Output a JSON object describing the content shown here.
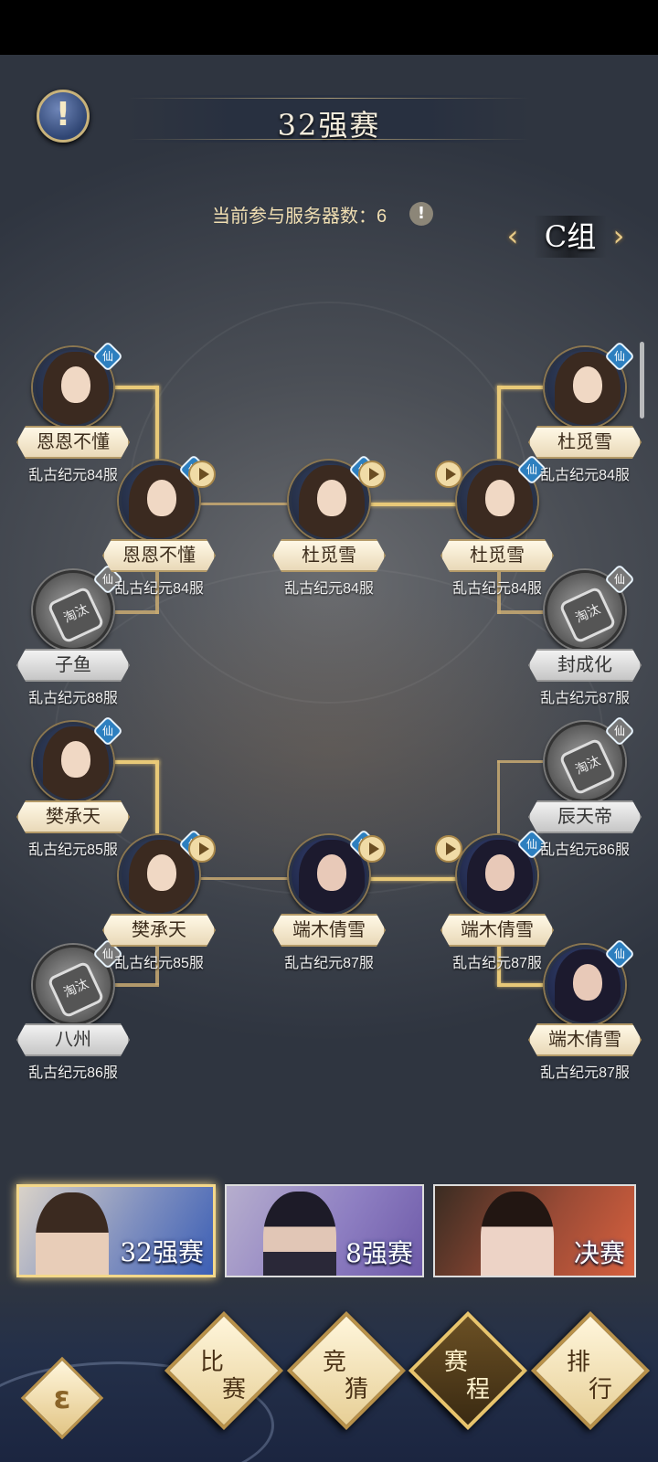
{
  "header": {
    "title": "32强赛",
    "server_count_label": "当前参与服务器数：6",
    "info_icon": "!",
    "small_info_icon": "!"
  },
  "group": {
    "label": "C组",
    "prev": "‹",
    "next": "›"
  },
  "badge_text": "仙",
  "bracket": {
    "top": {
      "left_r1": [
        {
          "name": "恩恩不懂",
          "server": "乱古纪元84服",
          "status": "winner"
        },
        {
          "name": "子鱼",
          "server": "乱古纪元88服",
          "status": "eliminated"
        }
      ],
      "left_r2": {
        "name": "恩恩不懂",
        "server": "乱古纪元84服"
      },
      "center": {
        "name": "杜觅雪",
        "server": "乱古纪元84服"
      },
      "right_r2": {
        "name": "杜觅雪",
        "server": "乱古纪元84服"
      },
      "right_r1": [
        {
          "name": "杜觅雪",
          "server": "乱古纪元84服",
          "status": "winner"
        },
        {
          "name": "封成化",
          "server": "乱古纪元87服",
          "status": "eliminated"
        }
      ]
    },
    "bottom": {
      "left_r1": [
        {
          "name": "樊承天",
          "server": "乱古纪元85服",
          "status": "winner"
        },
        {
          "name": "八州",
          "server": "乱古纪元86服",
          "status": "eliminated"
        }
      ],
      "left_r2": {
        "name": "樊承天",
        "server": "乱古纪元85服"
      },
      "center": {
        "name": "端木倩雪",
        "server": "乱古纪元87服"
      },
      "right_r2": {
        "name": "端木倩雪",
        "server": "乱古纪元87服"
      },
      "right_r1": [
        {
          "name": "辰天帝",
          "server": "乱古纪元86服",
          "status": "eliminated"
        },
        {
          "name": "端木倩雪",
          "server": "乱古纪元87服",
          "status": "winner"
        }
      ]
    },
    "eliminated_stamp": "淘汰"
  },
  "round_tabs": [
    {
      "label": "32强赛",
      "selected": true
    },
    {
      "label": "8强赛",
      "selected": false
    },
    {
      "label": "决赛",
      "selected": false
    }
  ],
  "nav": [
    {
      "c1": "比",
      "c2": "赛",
      "active": false
    },
    {
      "c1": "竞",
      "c2": "猜",
      "active": false
    },
    {
      "c1": "赛",
      "c2": "程",
      "active": true
    },
    {
      "c1": "排",
      "c2": "行",
      "active": false
    }
  ],
  "corner_icon": "ε"
}
